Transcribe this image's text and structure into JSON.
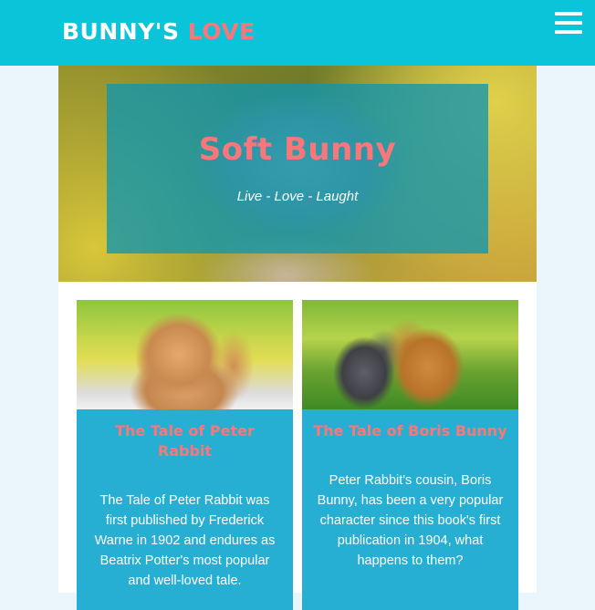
{
  "header": {
    "brand_part1": "BUNNY'S",
    "brand_part2": "LOVE",
    "menu_icon": "hamburger-menu-icon"
  },
  "hero": {
    "title": "Soft Bunny",
    "subtitle": "Live - Love - Laught"
  },
  "cards": [
    {
      "title": "The Tale of Peter Rabbit",
      "text": "The Tale of Peter Rabbit was first published by Frederick Warne in 1902 and endures as Beatrix Potter's most popular and well-loved tale."
    },
    {
      "title": "The Tale of Boris Bunny",
      "text": "Peter Rabbit's cousin, Boris Bunny, has been a very popular character since this book's first publication in 1904, what happens to them?"
    }
  ],
  "colors": {
    "header_bg": "#0ac4d9",
    "accent": "#f9777b",
    "card_bg": "#27afd3",
    "page_bg": "#eaf6fb"
  }
}
